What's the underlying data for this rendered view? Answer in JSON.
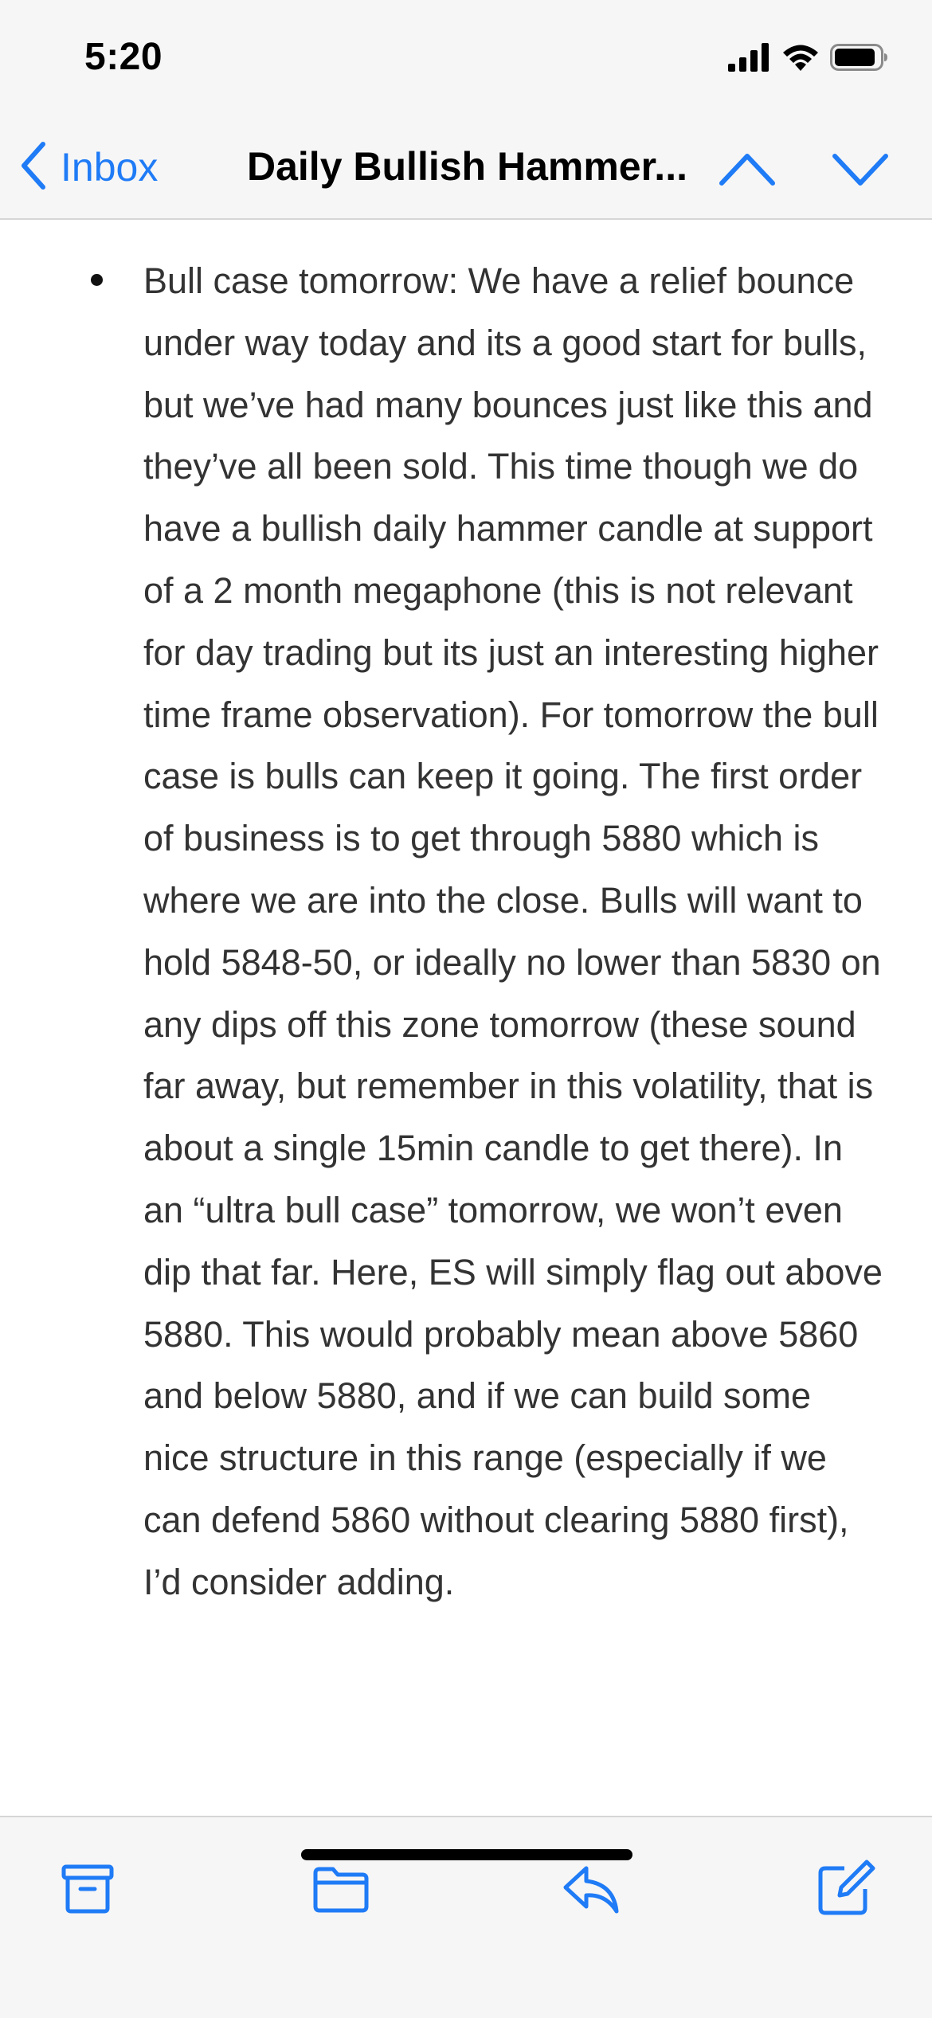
{
  "status_bar": {
    "time": "5:20",
    "icons": [
      "cellular-signal-icon",
      "wifi-icon",
      "battery-icon"
    ]
  },
  "nav": {
    "back_label": "Inbox",
    "title": "Daily Bullish Hammer...",
    "accent_color": "#1f7bf6"
  },
  "content": {
    "bullets": [
      "Bull case tomorrow: We have a relief bounce under way today and its a good start for bulls, but we’ve had many bounces just like this and they’ve all been sold. This time though we do have a bullish daily hammer candle at support of a 2 month megaphone (this is not relevant for day trading but its just an interesting higher time frame observation). For tomorrow the bull case is bulls can keep it going. The first order of business is to get through 5880 which is where we are into the close. Bulls will want to hold 5848-50, or ideally no lower than 5830 on any dips off this zone tomorrow (these sound far away, but remember in this volatility, that is about a single 15min candle to get there). In an “ultra bull case” tomorrow, we won’t even dip that far. Here, ES will simply flag out above 5880. This would probably mean above 5860 and below 5880, and if we can build some nice structure in this range (especially if we can defend 5860 without clearing 5880 first), I’d consider adding."
    ]
  },
  "toolbar": {
    "icons": [
      "archive-icon",
      "folder-icon",
      "reply-icon",
      "compose-icon"
    ]
  }
}
